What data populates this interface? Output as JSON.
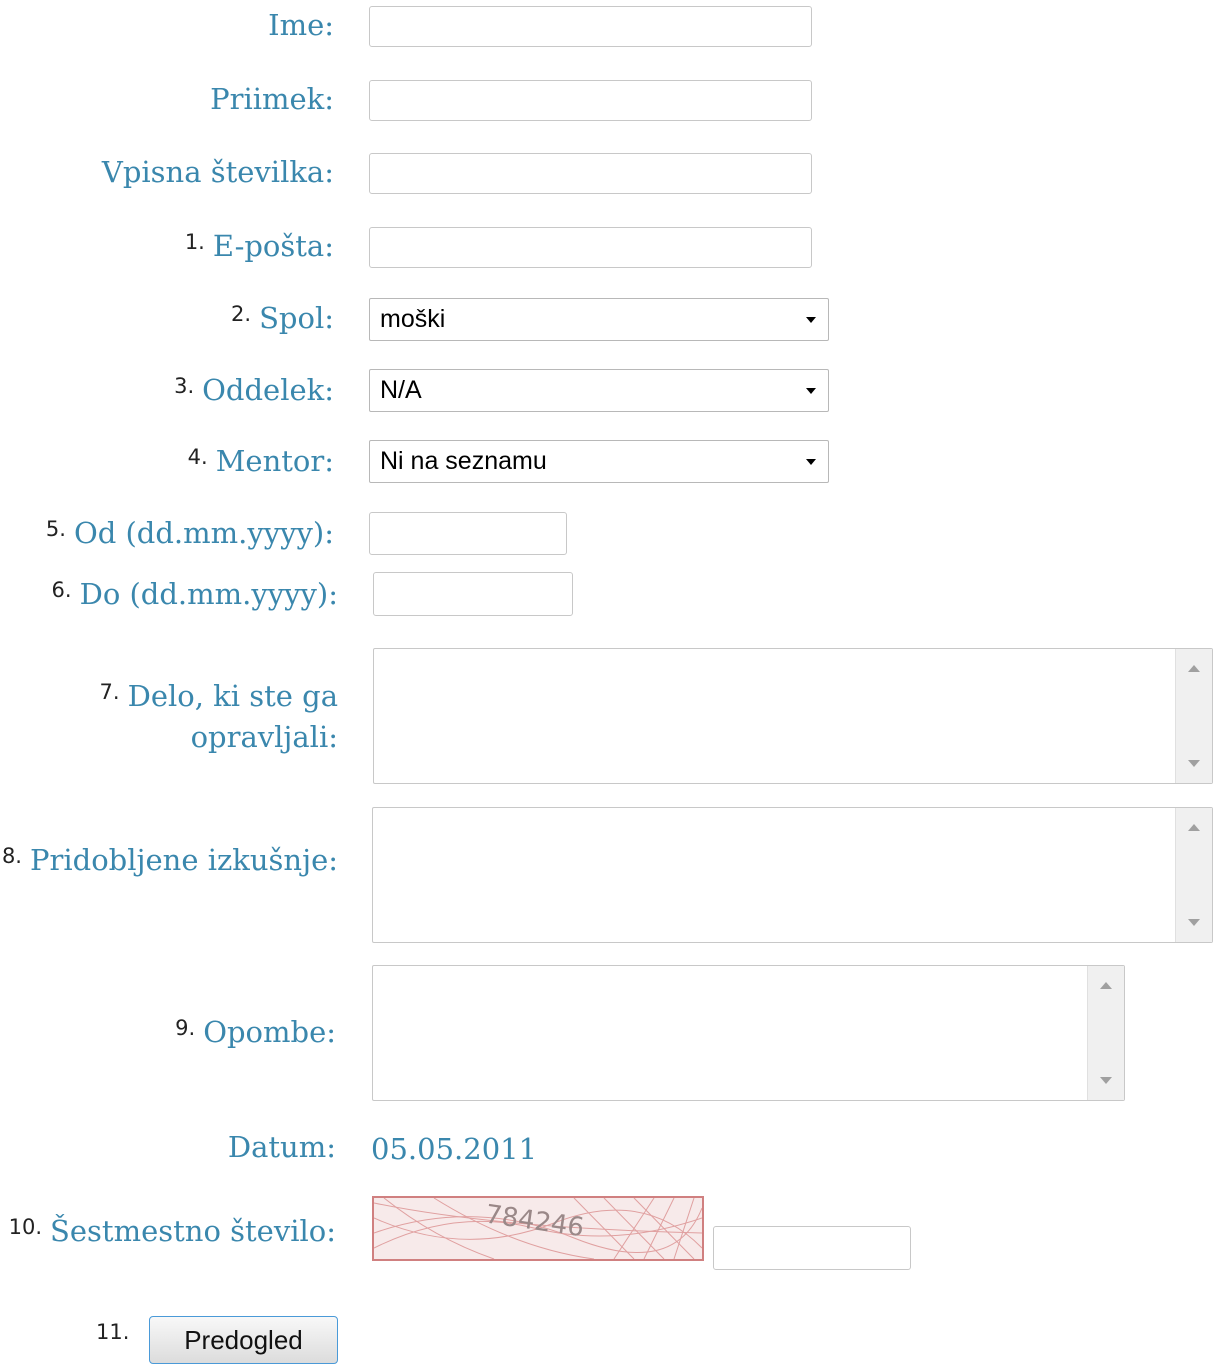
{
  "form": {
    "ime": {
      "label": "Ime:",
      "value": ""
    },
    "priimek": {
      "label": "Priimek:",
      "value": ""
    },
    "vpisna": {
      "label": "Vpisna številka:",
      "value": ""
    },
    "eposta": {
      "num": "1.",
      "label": "E-pošta:",
      "value": ""
    },
    "spol": {
      "num": "2.",
      "label": "Spol:",
      "value": "moški"
    },
    "oddelek": {
      "num": "3.",
      "label": "Oddelek:",
      "value": "N/A"
    },
    "mentor": {
      "num": "4.",
      "label": "Mentor:",
      "value": "Ni na seznamu"
    },
    "od": {
      "num": "5.",
      "label": "Od (dd.mm.yyyy):",
      "value": ""
    },
    "do": {
      "num": "6.",
      "label": "Do (dd.mm.yyyy):",
      "value": ""
    },
    "delo": {
      "num": "7.",
      "label_line1": "Delo, ki ste ga",
      "label_line2": "opravljali:",
      "value": ""
    },
    "izkusnje": {
      "num": "8.",
      "label": "Pridobljene izkušnje:",
      "value": ""
    },
    "opombe": {
      "num": "9.",
      "label": "Opombe:",
      "value": ""
    },
    "datum": {
      "label": "Datum:",
      "value": "05.05.2011"
    },
    "captcha": {
      "num": "10.",
      "label": "Šestmestno število:",
      "image_text": "784246",
      "value": ""
    },
    "preview": {
      "num": "11.",
      "label": "Predogled"
    }
  },
  "colors": {
    "label": "#3a87ad",
    "captcha_border": "#d08080"
  }
}
